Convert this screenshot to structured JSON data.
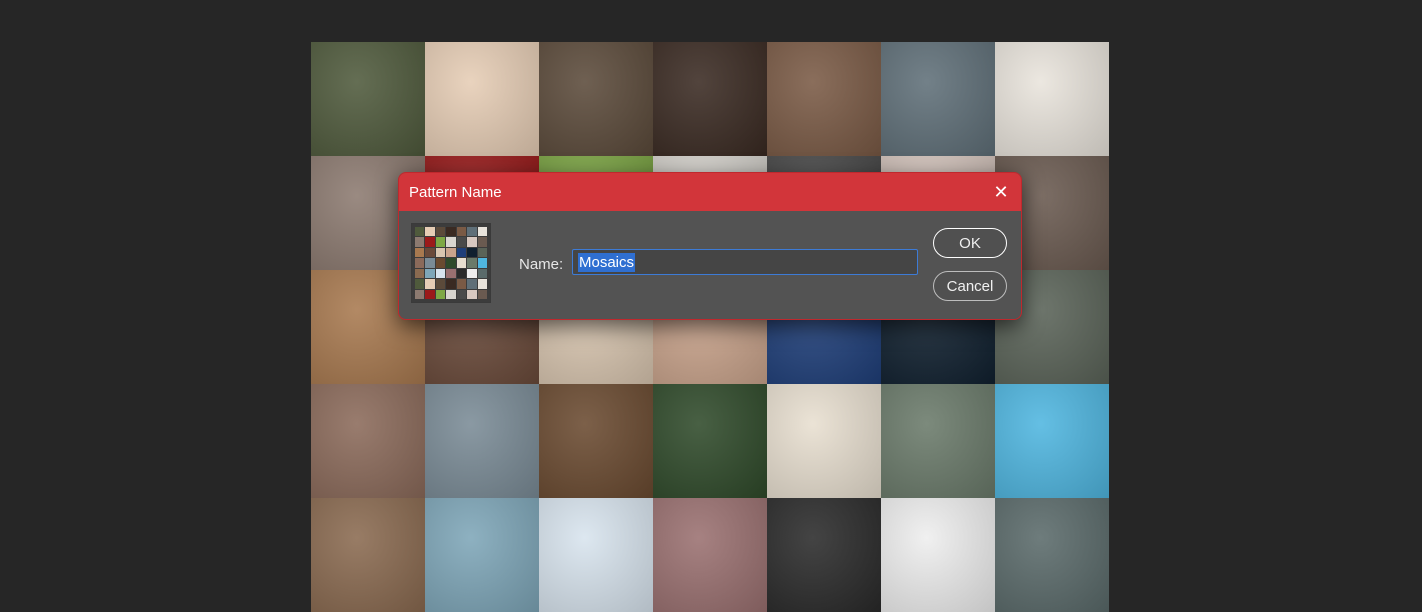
{
  "dialog": {
    "title": "Pattern Name",
    "name_label": "Name:",
    "name_value": "Mosaics",
    "ok_label": "OK",
    "cancel_label": "Cancel",
    "close_icon": "close-icon",
    "accent_color": "#d2353a"
  },
  "mosaic_colors": [
    "#4f5a3c",
    "#e6cdb5",
    "#5b4a3a",
    "#3a2a22",
    "#7a5a45",
    "#5f6f78",
    "#e9e4dc",
    "#8c7a70",
    "#9b1a1a",
    "#7ea845",
    "#d9d6d0",
    "#4a4a4a",
    "#d8c8c0",
    "#6a5a50",
    "#a8794f",
    "#6a4a3a",
    "#d9c6b0",
    "#caa48c",
    "#1f3f7a",
    "#10202f",
    "#5a6358",
    "#8b6a5a",
    "#7a8b96",
    "#6a4a30",
    "#2f4a2a",
    "#e8dfd0",
    "#6a7a6a",
    "#4fb6e0",
    "#8a6a50",
    "#7ea6b8",
    "#d8e4ee",
    "#9a7070",
    "#2a2a2a",
    "#eeeeee",
    "#5a6a6a"
  ]
}
